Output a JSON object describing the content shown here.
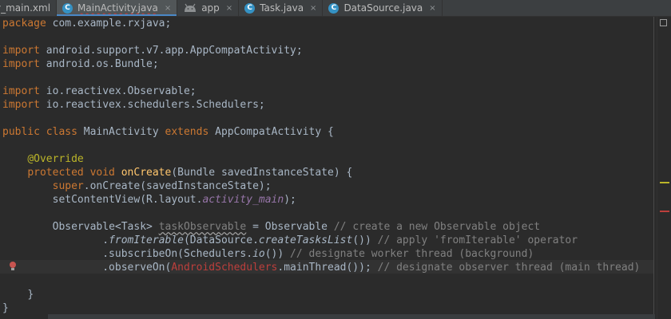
{
  "tabs": [
    {
      "label": "y_main.xml",
      "icon": "none",
      "active": false
    },
    {
      "label": "MainActivity.java",
      "icon": "C",
      "active": true
    },
    {
      "label": "app",
      "icon": "android-module-icon",
      "active": false
    },
    {
      "label": "Task.java",
      "icon": "C",
      "active": false
    },
    {
      "label": "DataSource.java",
      "icon": "C",
      "active": false
    }
  ],
  "tab_close_glyph": "×",
  "class_icon_letter": "C",
  "code": {
    "package_kw": "package",
    "package_name": " com.example.rxjava;",
    "import_kw": "import",
    "import1": " android.support.v7.app.AppCompatActivity;",
    "import2": " android.os.Bundle;",
    "import3": " io.reactivex.Observable;",
    "import4": " io.reactivex.schedulers.Schedulers;",
    "class_decl_public_class": "public class",
    "class_decl_name": " MainActivity ",
    "class_decl_extends": "extends",
    "class_decl_rest": " AppCompatActivity {",
    "override": "@Override",
    "method_mods": "protected void",
    "method_name": "onCreate",
    "method_params": "(Bundle savedInstanceState) {",
    "super_kw": "super",
    "super_call": ".onCreate(savedInstanceState);",
    "set_content_a": "setContentView(R.layout.",
    "set_content_field": "activity_main",
    "set_content_b": ");",
    "obs_type": "Observable<Task> ",
    "obs_var": "taskObservable",
    "obs_assign": " = Observable ",
    "obs_comment": "// create a new Observable object",
    "from_dot": ".",
    "from_method": "fromIterable",
    "from_args_a": "(DataSource.",
    "from_args_static": "createTasksList",
    "from_args_b": "()) ",
    "from_comment": "// apply 'fromIterable' operator",
    "subscribe_a": ".subscribeOn(Schedulers.",
    "subscribe_static": "io",
    "subscribe_b": "()) ",
    "subscribe_comment": "// designate worker thread (background)",
    "observe_a": ".observeOn(",
    "observe_err": "AndroidSchedulers",
    "observe_b": ".mainThread()); ",
    "observe_comment": "// designate observer thread (main thread)",
    "close_method": "}",
    "close_class": "}"
  },
  "colors": {
    "keyword": "#cc7832",
    "annotation": "#bbb529",
    "method": "#ffc66d",
    "field": "#9876aa",
    "comment": "#808080",
    "error": "#bc3f3c",
    "text": "#a9b7c6",
    "background": "#2b2b2b"
  },
  "gutter_icon": "breakpoint-bulb-icon"
}
